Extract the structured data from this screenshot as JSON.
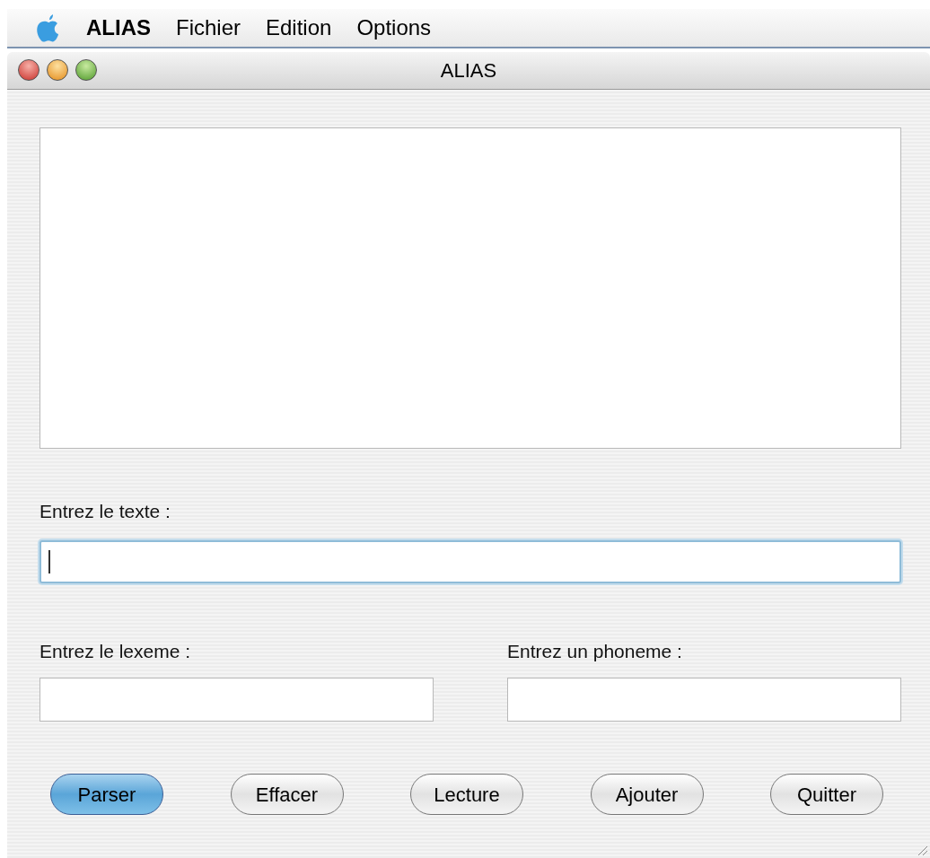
{
  "menu_bar": {
    "app_name": "ALIAS",
    "items": [
      "Fichier",
      "Edition",
      "Options"
    ]
  },
  "window": {
    "title": "ALIAS"
  },
  "text_field": {
    "label": "Entrez le texte :",
    "focused": true
  },
  "lexeme_field": {
    "label": "Entrez le lexeme :",
    "focused": false
  },
  "phoneme_field": {
    "label": "Entrez un phoneme :",
    "focused": false
  },
  "buttons": [
    {
      "label": "Parser",
      "default": true
    },
    {
      "label": "Effacer",
      "default": false
    },
    {
      "label": "Lecture",
      "default": false
    },
    {
      "label": "Ajouter",
      "default": false
    },
    {
      "label": "Quitter",
      "default": false
    }
  ]
}
